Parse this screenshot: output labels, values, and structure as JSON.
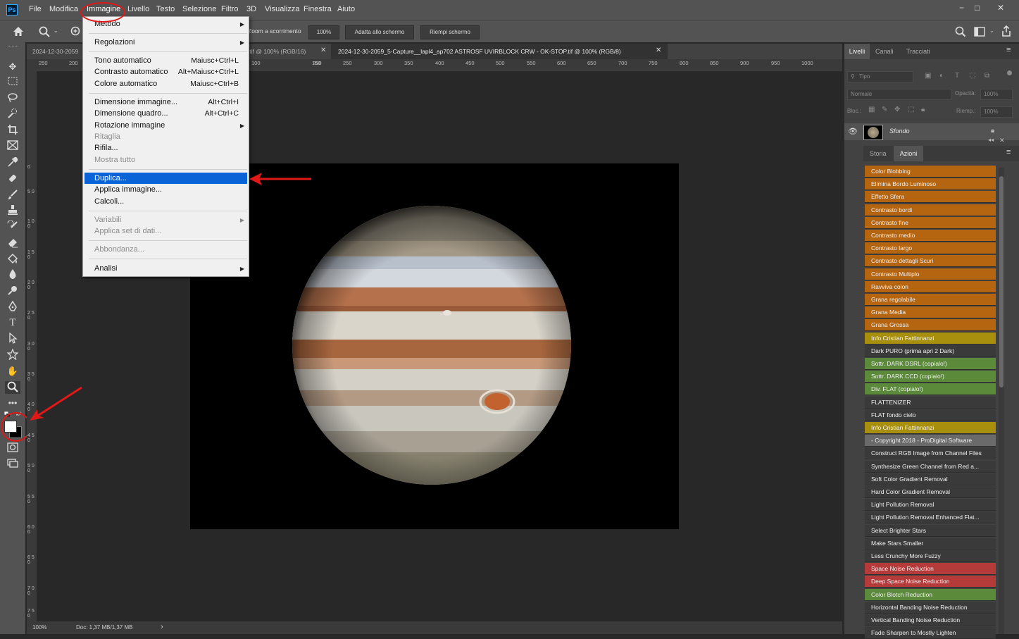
{
  "app_logo": "Ps",
  "menubar": [
    "File",
    "Modifica",
    "Immagine",
    "Livello",
    "Testo",
    "Selezione",
    "Filtro",
    "3D",
    "Visualizza",
    "Finestra",
    "Aiuto"
  ],
  "window_controls": [
    "−",
    "□",
    "✕"
  ],
  "options": {
    "scroll_all": "Zoom a scorrimento",
    "zoom_pct": "100%",
    "fit_screen": "Adatta allo schermo",
    "fill_screen": "Riempi schermo"
  },
  "tabs": {
    "tab1": "2024-12-30-2059",
    "tab1_suffix": ".tif @ 100% (RGB/16)",
    "tab2": "2024-12-30-2059_5-Capture__lapl4_ap702 ASTROSF UVIRBLOCK CRW - OK-STOP.tif @ 100% (RGB/8)"
  },
  "ruler_top": [
    "250",
    "200",
    "100",
    "150",
    "200",
    "250",
    "300",
    "350",
    "400",
    "450",
    "500",
    "550",
    "600",
    "650",
    "700",
    "750",
    "800",
    "850",
    "900",
    "950",
    "1000"
  ],
  "ruler_left": [
    "0",
    "5 0",
    "1 0 0",
    "1 5 0",
    "2 0 0",
    "2 5 0",
    "3 0 0",
    "3 5 0",
    "4 0 0",
    "4 5 0",
    "5 0 0",
    "5 5 0",
    "6 0 0",
    "6 5 0",
    "7 0 0",
    "7 5 0"
  ],
  "status": {
    "zoom": "100%",
    "doc": "Doc: 1,37 MB/1,37 MB",
    "arrow": "›"
  },
  "menu": {
    "metodo": "Metodo",
    "regolazioni": "Regolazioni",
    "tono": "Tono automatico",
    "tono_sc": "Maiusc+Ctrl+L",
    "contrasto": "Contrasto automatico",
    "contrasto_sc": "Alt+Maiusc+Ctrl+L",
    "colore": "Colore automatico",
    "colore_sc": "Maiusc+Ctrl+B",
    "dim_img": "Dimensione immagine...",
    "dim_img_sc": "Alt+Ctrl+I",
    "dim_quad": "Dimensione quadro...",
    "dim_quad_sc": "Alt+Ctrl+C",
    "rotazione": "Rotazione immagine",
    "ritaglia": "Ritaglia",
    "rifila": "Rifila...",
    "mostra": "Mostra tutto",
    "duplica": "Duplica...",
    "applica": "Applica immagine...",
    "calcoli": "Calcoli...",
    "variabili": "Variabili",
    "applica_set": "Applica set di dati...",
    "abbondanza": "Abbondanza...",
    "analisi": "Analisi"
  },
  "layers_panel": {
    "tabs": [
      "Livelli",
      "Canali",
      "Tracciati"
    ],
    "search": "Tipo",
    "blend": "Normale",
    "opacity_label": "Opacità:",
    "opacity": "100%",
    "lock_label": "Bloc.:",
    "fill_label": "Riemp.:",
    "fill": "100%",
    "layer_name": "Sfondo"
  },
  "actions_panel": {
    "tabs": [
      "Storia",
      "Azioni"
    ],
    "items": [
      {
        "label": "Color Blobbing",
        "color": "#b5650f"
      },
      {
        "label": "Elimina Bordo Luminoso",
        "color": "#b5650f"
      },
      {
        "label": "Effetto Sfera",
        "color": "#b5650f"
      },
      {
        "label": "Contrasto bordi",
        "color": "#b5650f"
      },
      {
        "label": "Contrasto fine",
        "color": "#b5650f"
      },
      {
        "label": "Contrasto medio",
        "color": "#b5650f"
      },
      {
        "label": "Contrasto largo",
        "color": "#b5650f"
      },
      {
        "label": "Contrasto dettagli Scuri",
        "color": "#b5650f"
      },
      {
        "label": "Contrasto Multiplo",
        "color": "#b5650f"
      },
      {
        "label": "Ravviva colori",
        "color": "#b5650f"
      },
      {
        "label": "Grana regolabile",
        "color": "#b5650f"
      },
      {
        "label": "Grana Media",
        "color": "#b5650f"
      },
      {
        "label": "Grana Grossa",
        "color": "#b5650f"
      },
      {
        "label": "Info Cristian Fattinnanzi",
        "color": "#a8900e"
      },
      {
        "label": "Dark PURO (prima apri 2 Dark)",
        "color": "#3a3a3a"
      },
      {
        "label": "Sottr. DARK DSRL (copialo!)",
        "color": "#5b8a3a"
      },
      {
        "label": "Sottr. DARK CCD (copialo!)",
        "color": "#5b8a3a"
      },
      {
        "label": "Div. FLAT (copialo!)",
        "color": "#5b8a3a"
      },
      {
        "label": "FLATTENIZER",
        "color": "#3a3a3a"
      },
      {
        "label": "FLAT fondo cielo",
        "color": "#3a3a3a"
      },
      {
        "label": "Info Cristian Fattinnanzi",
        "color": "#a8900e"
      },
      {
        "label": "- Copyright 2018 - ProDigital Software",
        "color": "#6a6a6a"
      },
      {
        "label": "Construct RGB Image from Channel Files",
        "color": "#3a3a3a"
      },
      {
        "label": "Synthesize Green Channel from Red a...",
        "color": "#3a3a3a"
      },
      {
        "label": "Soft Color Gradient Removal",
        "color": "#3a3a3a"
      },
      {
        "label": "Hard Color Gradient Removal",
        "color": "#3a3a3a"
      },
      {
        "label": "Light Pollution Removal",
        "color": "#3a3a3a"
      },
      {
        "label": "Light Pollution Removal Enhanced Flat...",
        "color": "#3a3a3a"
      },
      {
        "label": "Select Brighter Stars",
        "color": "#3a3a3a"
      },
      {
        "label": "Make Stars Smaller",
        "color": "#3a3a3a"
      },
      {
        "label": "Less Crunchy More Fuzzy",
        "color": "#3a3a3a"
      },
      {
        "label": "Space Noise Reduction",
        "color": "#b53b3b"
      },
      {
        "label": "Deep Space Noise Reduction",
        "color": "#b53b3b"
      },
      {
        "label": "Color Blotch Reduction",
        "color": "#5b8a3a"
      },
      {
        "label": "Horizontal Banding Noise Reduction",
        "color": "#3a3a3a"
      },
      {
        "label": "Vertical Banding Noise Reduction",
        "color": "#3a3a3a"
      },
      {
        "label": "Fade Sharpen to Mostly Lighten",
        "color": "#3a3a3a"
      }
    ]
  },
  "annotation_color": "#e01818"
}
